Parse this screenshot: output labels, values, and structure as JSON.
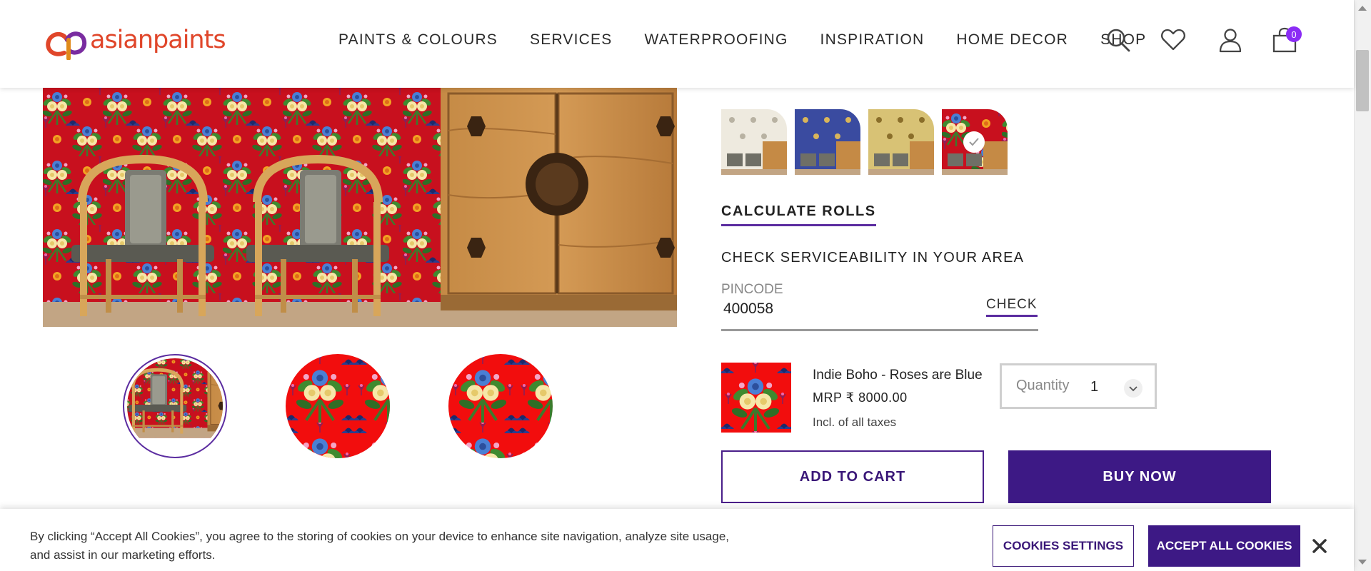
{
  "header": {
    "logo_text": "asianpaints",
    "nav": [
      "PAINTS & COLOURS",
      "SERVICES",
      "WATERPROOFING",
      "INSPIRATION",
      "HOME DECOR",
      "SHOP"
    ],
    "icons": [
      "search-icon",
      "wishlist-heart-icon",
      "account-user-icon",
      "cart-bag-icon"
    ],
    "cart_count": "0"
  },
  "colors": {
    "brand_purple": "#3d1985",
    "accent_purple": "#5b2ca0",
    "logo_red": "#e0462a",
    "wallpaper_red": "#c8101e",
    "badge_purple": "#8b2cf5"
  },
  "gallery": {
    "thumbnails": [
      "room-view",
      "pattern-closeup-1",
      "pattern-closeup-2"
    ],
    "active_index": 0
  },
  "swatches": {
    "variants": [
      "white",
      "blue",
      "yellow",
      "red"
    ],
    "selected": "red"
  },
  "product": {
    "calculate_rolls": "CALCULATE ROLLS",
    "serviceability_title": "CHECK SERVICEABILITY IN YOUR AREA",
    "pincode_label": "PINCODE",
    "pincode_value": "400058",
    "check_label": "CHECK",
    "name": "Indie Boho - Roses are Blue",
    "price": "MRP ₹ 8000.00",
    "tax_note": "Incl. of all taxes",
    "quantity_label": "Quantity",
    "quantity_value": "1",
    "add_to_cart": "ADD TO CART",
    "buy_now": "BUY NOW"
  },
  "cookie": {
    "text": "By clicking “Accept All Cookies”, you agree to the storing of cookies on your device to enhance site navigation, analyze site usage, and assist in our marketing efforts.",
    "settings_label": "COOKIES SETTINGS",
    "accept_label": "ACCEPT ALL COOKIES"
  }
}
